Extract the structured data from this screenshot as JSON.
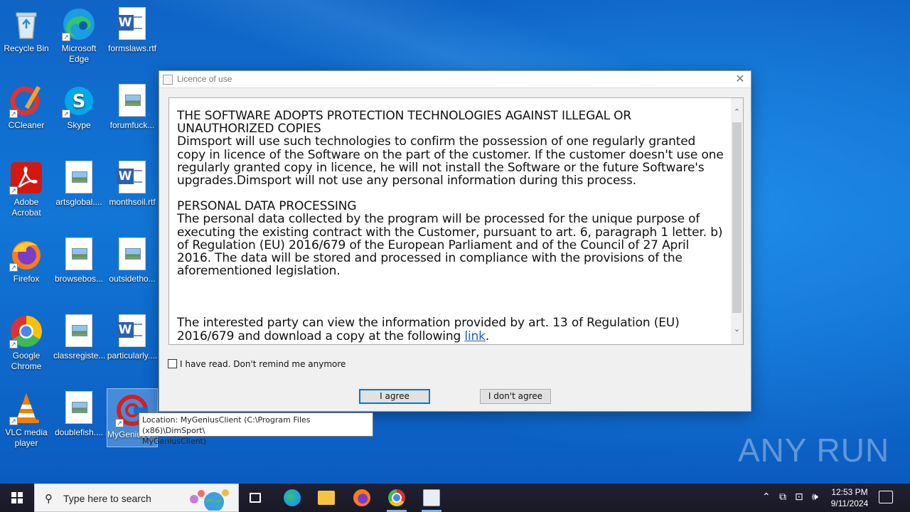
{
  "desktop": {
    "icons": [
      {
        "label": "Recycle Bin"
      },
      {
        "label": "Microsoft Edge"
      },
      {
        "label": "formslaws.rtf"
      },
      {
        "label": "CCleaner"
      },
      {
        "label": "Skype"
      },
      {
        "label": "forumfuck..."
      },
      {
        "label": "Adobe Acrobat"
      },
      {
        "label": "artsglobal...."
      },
      {
        "label": "monthsoil.rtf"
      },
      {
        "label": "Firefox"
      },
      {
        "label": "browsebos..."
      },
      {
        "label": "outsidetho..."
      },
      {
        "label": "Google Chrome"
      },
      {
        "label": "classregiste..."
      },
      {
        "label": "particularly...."
      },
      {
        "label": "VLC media player"
      },
      {
        "label": "doublefish...."
      },
      {
        "label": "MyGeniusClient"
      }
    ],
    "tooltip_line1": "Location: MyGeniusClient (C:\\Program Files (x86)\\DimSport\\",
    "tooltip_line2": "MyGeniusClient)",
    "watermark": "ANY RUN"
  },
  "dialog": {
    "title": "Licence of use",
    "close_glyph": "✕",
    "text": {
      "h1": "THE SOFTWARE ADOPTS PROTECTION TECHNOLOGIES AGAINST ILLEGAL OR UNAUTHORIZED COPIES",
      "p1": "Dimsport will use such technologies to confirm the possession of one regularly granted copy in licence of the Software on the part of the customer. If the customer doesn't use one regularly granted copy in licence, he will not install the Software or the future Software's upgrades.Dimsport will not use any personal information during this process.",
      "h2": "PERSONAL DATA PROCESSING",
      "p2": "The personal data collected by the program will be processed for the unique purpose of executing the existing contract with the Customer, pursuant to art. 6, paragraph 1 letter. b) of Regulation (EU) 2016/679 of the European Parliament and of the Council of 27 April 2016. The data will be stored and processed in compliance with the provisions of the aforementioned legislation.",
      "p3": "The interested party can view the information provided by art. 13 of Regulation (EU) 2016/679 and download a copy at the following ",
      "link": "link",
      "p3_end": "."
    },
    "checkbox_label": "I have read. Don't remind me anymore",
    "checkbox_checked": false,
    "agree_label": "I agree",
    "disagree_label": "I don't agree"
  },
  "taskbar": {
    "search_placeholder": "Type here to search",
    "time": "12:53 PM",
    "date": "9/11/2024"
  }
}
